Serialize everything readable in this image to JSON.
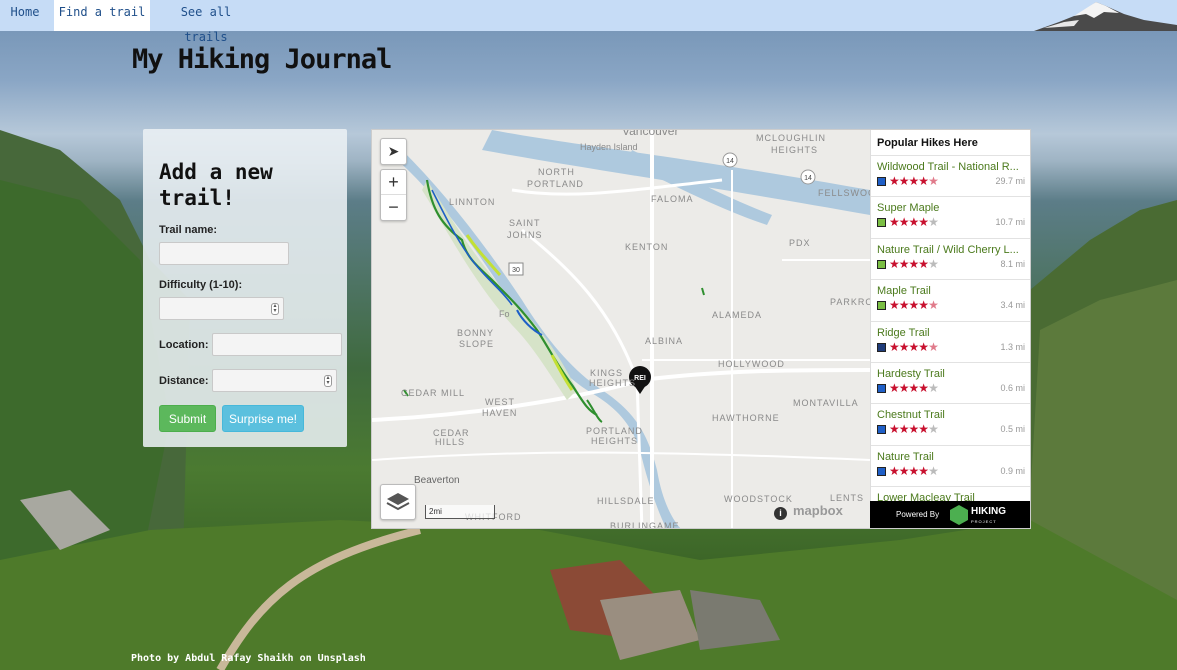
{
  "nav": {
    "home": "Home",
    "find": "Find a trail",
    "all": "See all trails"
  },
  "title": "My Hiking Journal",
  "form": {
    "heading": "Add a new trail!",
    "trail_name_label": "Trail name:",
    "difficulty_label": "Difficulty (1-10):",
    "location_label": "Location:",
    "distance_label": "Distance:",
    "submit": "Submit",
    "surprise": "Surprise me!"
  },
  "map": {
    "labels": {
      "vancouver": "Vancouver",
      "hayden": "Hayden Island",
      "mcloughlin": "MCLOUGHLIN",
      "heights": "HEIGHTS",
      "north": "NORTH",
      "portland_n": "PORTLAND",
      "linnton": "LINNTON",
      "faloma": "FALOMA",
      "fellswood": "FELLSWOOD",
      "saint": "SAINT",
      "johns": "JOHNS",
      "kenton": "KENTON",
      "pdx": "PDX",
      "parkrose": "PARKRO",
      "alameda": "ALAMEDA",
      "bonny": "BONNY",
      "slope": "SLOPE",
      "forest": "Fo",
      "albina": "ALBINA",
      "hollywood": "HOLLYWOOD",
      "kings": "KINGS",
      "kheights": "HEIGHTS",
      "cedarmill": "CEDAR MILL",
      "west": "WEST",
      "haven": "HAVEN",
      "montavilla": "MONTAVILLA",
      "hawthorne": "HAWTHORNE",
      "cedar": "CEDAR",
      "hills": "HILLS",
      "portland": "PORTLAND",
      "pheights": "HEIGHTS",
      "beaverton": "Beaverton",
      "hillsdale": "HILLSDALE",
      "woodstock": "WOODSTOCK",
      "lents": "LENTS",
      "whitford": "WHITFORD",
      "burlingame": "BURLINGAME"
    },
    "shields": [
      "14",
      "14",
      "30"
    ],
    "zoom_in": "+",
    "zoom_out": "−",
    "scale": "2mi",
    "info": "i",
    "mapbox": "mapbox"
  },
  "hikes_panel": {
    "heading": "Popular Hikes Here",
    "hikes": [
      {
        "name": "Wildwood Trail - National R...",
        "diff_color": "#1f5fc7",
        "stars": 4.5,
        "distance": "29.7 mi"
      },
      {
        "name": "Super Maple",
        "diff_color": "#7bbf44",
        "stars": 4,
        "distance": "10.7 mi"
      },
      {
        "name": "Nature Trail / Wild Cherry L...",
        "diff_color": "#7bbf44",
        "stars": 4,
        "distance": "8.1 mi"
      },
      {
        "name": "Maple Trail",
        "diff_color": "#7bbf44",
        "stars": 4.5,
        "distance": "3.4 mi"
      },
      {
        "name": "Ridge Trail",
        "diff_color": "#1f3c7a",
        "stars": 4.5,
        "distance": "1.3 mi"
      },
      {
        "name": "Hardesty Trail",
        "diff_color": "#1f5fc7",
        "stars": 4,
        "distance": "0.6 mi"
      },
      {
        "name": "Chestnut Trail",
        "diff_color": "#1f5fc7",
        "stars": 4,
        "distance": "0.5 mi"
      },
      {
        "name": "Nature Trail",
        "diff_color": "#1f5fc7",
        "stars": 4,
        "distance": "0.9 mi"
      },
      {
        "name": "Lower Macleay Trail",
        "diff_color": "#1f5fc7",
        "stars": 4,
        "distance": ""
      }
    ],
    "powered_by": "Powered By",
    "brand": "HIKING",
    "brand_sub": "PROJECT"
  },
  "credit": "Photo by Abdul Rafay Shaikh on Unsplash",
  "colors": {
    "nav_bg": "#c6dcf6",
    "accent_green": "#5cb85c",
    "accent_blue": "#5bc0de",
    "star_red": "#c8102e"
  }
}
